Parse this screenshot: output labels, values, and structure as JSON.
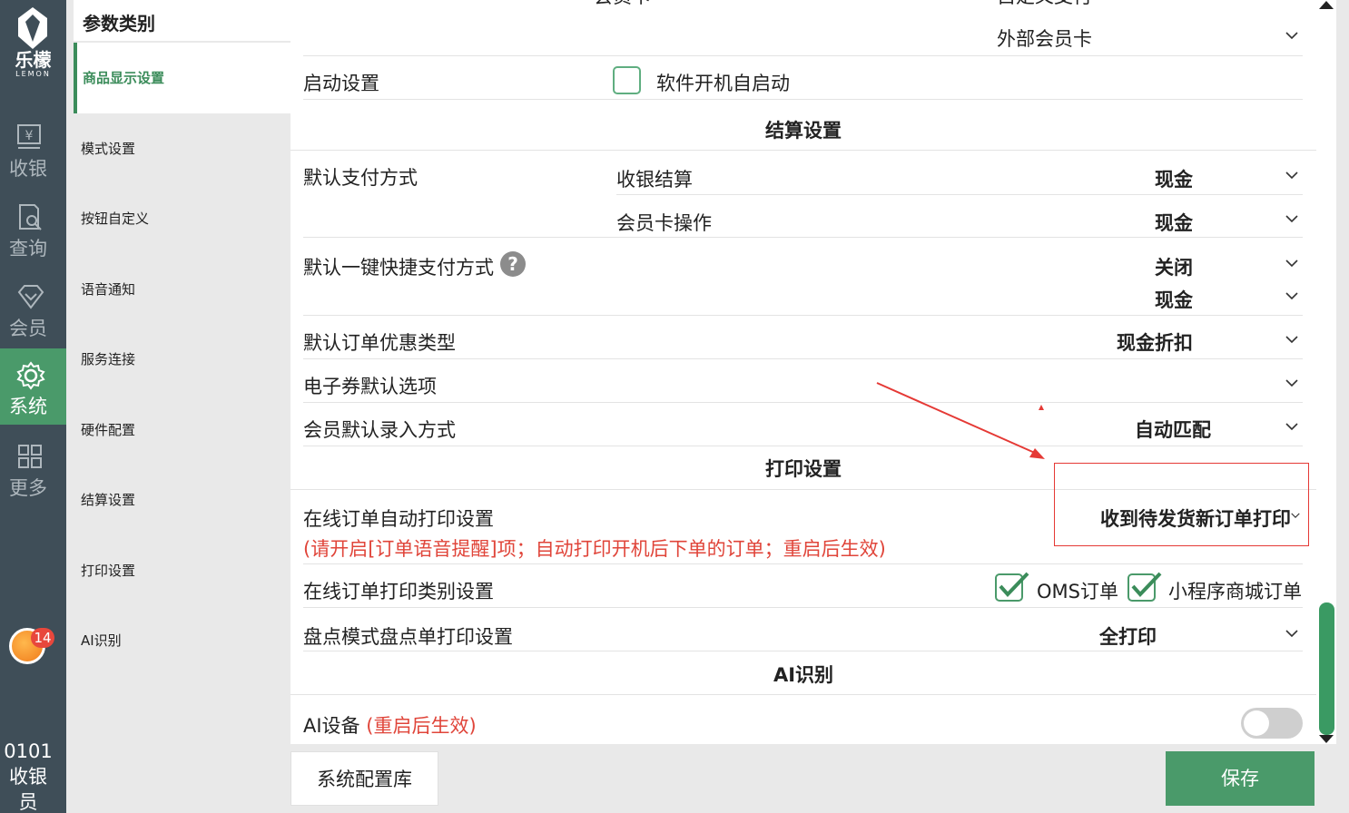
{
  "brand": {
    "name": "乐檬",
    "sub": "LEMON"
  },
  "nav": {
    "items": [
      {
        "label": "收银",
        "icon": "cashier-icon"
      },
      {
        "label": "查询",
        "icon": "query-icon"
      },
      {
        "label": "会员",
        "icon": "member-icon"
      },
      {
        "label": "系统",
        "icon": "gear-icon",
        "active": true
      },
      {
        "label": "更多",
        "icon": "grid-icon"
      }
    ],
    "badge_count": "14",
    "user_id": "0101",
    "user_role": "收银员"
  },
  "categories": {
    "title": "参数类别",
    "items": [
      "商品显示设置",
      "模式设置",
      "按钮自定义",
      "语音通知",
      "服务连接",
      "硬件配置",
      "结算设置",
      "打印设置",
      "AI识别"
    ],
    "active_index": 0
  },
  "settings": {
    "top_partial_left": "会员卡",
    "top_partial_right": "自定义支付",
    "external_card": "外部会员卡",
    "startup": {
      "label": "启动设置",
      "checkbox_label": "软件开机自启动",
      "checked": false
    },
    "settlement_title": "结算设置",
    "default_payment": {
      "label": "默认支付方式",
      "rows": [
        {
          "sub": "收银结算",
          "value": "现金"
        },
        {
          "sub": "会员卡操作",
          "value": "现金"
        }
      ]
    },
    "quick_pay": {
      "label": "默认一键快捷支付方式",
      "help": "?",
      "values": [
        "关闭",
        "现金"
      ]
    },
    "order_discount": {
      "label": "默认订单优惠类型",
      "value": "现金折扣"
    },
    "ecoupon": {
      "label": "电子券默认选项",
      "value": ""
    },
    "member_input": {
      "label": "会员默认录入方式",
      "value": "自动匹配"
    },
    "print_title": "打印设置",
    "online_auto_print": {
      "label": "在线订单自动打印设置",
      "note": "(请开启[订单语音提醒]项；自动打印开机后下单的订单；重启后生效)",
      "value": "收到待发货新订单打印"
    },
    "online_print_type": {
      "label": "在线订单打印类别设置",
      "options": [
        {
          "label": "OMS订单",
          "checked": true
        },
        {
          "label": "小程序商城订单",
          "checked": true
        }
      ]
    },
    "stocktake_print": {
      "label": "盘点模式盘点单打印设置",
      "value": "全打印"
    },
    "ai_title": "AI识别",
    "ai_device": {
      "label": "AI设备",
      "note": "(重启后生效)",
      "enabled": false
    }
  },
  "footer": {
    "config_lib": "系统配置库",
    "save": "保存"
  },
  "colors": {
    "accent": "#4a9a6a",
    "nav_bg": "#3f4e58",
    "warning": "#e0453a",
    "annotation": "#e53935"
  }
}
